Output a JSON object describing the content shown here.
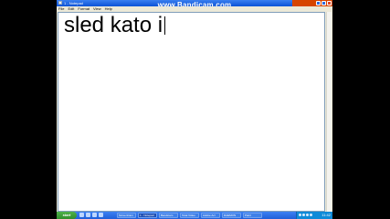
{
  "window": {
    "title": "1 - Notepad",
    "watermark": "www.Bandicam.com"
  },
  "menu": [
    "File",
    "Edit",
    "Format",
    "View",
    "Help"
  ],
  "editor": {
    "text": "sled kato i"
  },
  "taskbar": {
    "start_label": "start",
    "tasks": [
      "ScreenCam",
      "1 - Notepad",
      "Bandicam",
      "Total Video",
      "Adobe Acr",
      "DAEMON",
      "Paint"
    ],
    "clock": "11:42"
  },
  "colors": {
    "titlebar": "#0b52d6",
    "taskbar": "#1f5fd8",
    "start": "#2f8d2c",
    "bandicam": "#d64500"
  }
}
